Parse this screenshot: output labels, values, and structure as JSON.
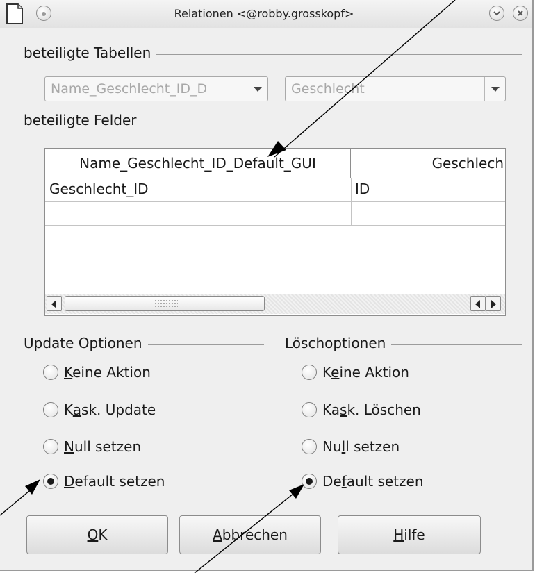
{
  "window": {
    "title": "Relationen <@robby.grosskopf>"
  },
  "tables_group": {
    "label": "beteiligte Tabellen",
    "left_combo_value": "Name_Geschlecht_ID_D",
    "right_combo_value": "Geschlecht"
  },
  "fields_group": {
    "label": "beteiligte Felder",
    "columns": [
      "Name_Geschlecht_ID_Default_GUI",
      "Geschlech"
    ],
    "rows": [
      [
        "Geschlecht_ID",
        "ID"
      ],
      [
        "",
        ""
      ]
    ]
  },
  "update_options": {
    "label": "Update Optionen",
    "items": [
      {
        "mnemonic": "K",
        "rest": "eine Aktion",
        "pre": "",
        "checked": false
      },
      {
        "pre": "K",
        "mnemonic": "a",
        "rest": "sk. Update",
        "checked": false
      },
      {
        "pre": "",
        "mnemonic": "N",
        "rest": "ull setzen",
        "checked": false
      },
      {
        "pre": "",
        "mnemonic": "D",
        "rest": "efault setzen",
        "checked": true
      }
    ]
  },
  "delete_options": {
    "label": "Löschoptionen",
    "items": [
      {
        "pre": "K",
        "mnemonic": "e",
        "rest": "ine Aktion",
        "checked": false
      },
      {
        "pre": "Ka",
        "mnemonic": "s",
        "rest": "k. Löschen",
        "checked": false
      },
      {
        "pre": "Nu",
        "mnemonic": "l",
        "rest": "l setzen",
        "checked": false
      },
      {
        "pre": "De",
        "mnemonic": "f",
        "rest": "ault setzen",
        "checked": true
      }
    ]
  },
  "buttons": {
    "ok": {
      "pre": "",
      "mnemonic": "O",
      "rest": "K"
    },
    "cancel": {
      "pre": "",
      "mnemonic": "A",
      "rest": "bbrechen"
    },
    "help": {
      "pre": "",
      "mnemonic": "H",
      "rest": "ilfe"
    }
  },
  "colors": {
    "dialog_bg": "#efefef",
    "disabled_text": "#a8a8a8",
    "annotation_arrow": "#000000"
  }
}
